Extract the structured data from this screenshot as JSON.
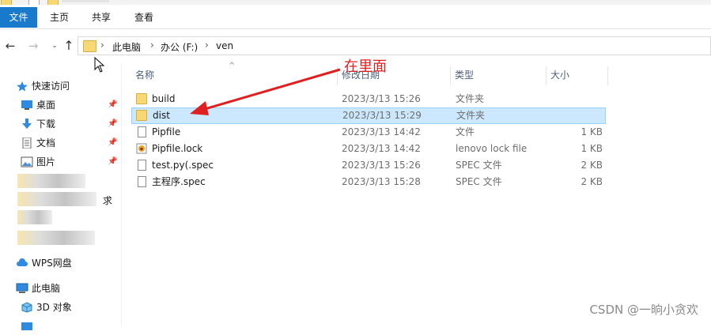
{
  "ribbon": {
    "tabs": [
      "文件",
      "主页",
      "共享",
      "查看"
    ]
  },
  "address": {
    "crumbs": [
      "此电脑",
      "办公 (F:)",
      "ven"
    ],
    "separator": "›"
  },
  "nav_glyphs": {
    "back": "←",
    "forward": "→",
    "recent": "⌄",
    "up": "↑"
  },
  "sidebar": {
    "quick_access": "快速访问",
    "items": [
      {
        "label": "桌面",
        "icon": "desktop-icon",
        "pinned": true
      },
      {
        "label": "下载",
        "icon": "download-icon",
        "pinned": true
      },
      {
        "label": "文档",
        "icon": "document-icon",
        "pinned": true
      },
      {
        "label": "图片",
        "icon": "picture-icon",
        "pinned": true
      }
    ],
    "blurred_fragment": "求",
    "wps": "WPS网盘",
    "this_pc": "此电脑",
    "objects_3d": "3D 对象",
    "pin_glyph": "📌"
  },
  "columns": {
    "name": "名称",
    "date": "修改日期",
    "type": "类型",
    "size": "大小",
    "sort_glyph": "^"
  },
  "files": [
    {
      "name": "build",
      "date": "2023/3/13 15:26",
      "type": "文件夹",
      "size": "",
      "icon": "folder-icon",
      "selected": false
    },
    {
      "name": "dist",
      "date": "2023/3/13 15:29",
      "type": "文件夹",
      "size": "",
      "icon": "folder-icon",
      "selected": true
    },
    {
      "name": "Pipfile",
      "date": "2023/3/13 14:42",
      "type": "文件",
      "size": "1 KB",
      "icon": "file-icon",
      "selected": false
    },
    {
      "name": "Pipfile.lock",
      "date": "2023/3/13 14:42",
      "type": "lenovo lock file",
      "size": "1 KB",
      "icon": "lock-file-icon",
      "selected": false
    },
    {
      "name": "test.py(.spec",
      "date": "2023/3/13 15:26",
      "type": "SPEC 文件",
      "size": "2 KB",
      "icon": "file-icon",
      "selected": false
    },
    {
      "name": "主程序.spec",
      "date": "2023/3/13 15:28",
      "type": "SPEC 文件",
      "size": "2 KB",
      "icon": "file-icon",
      "selected": false
    }
  ],
  "annotation": "在里面",
  "watermark": "CSDN @一晌小贪欢",
  "colors": {
    "accent": "#1979ca",
    "selection": "#cce8ff",
    "annotation": "#e02020"
  }
}
